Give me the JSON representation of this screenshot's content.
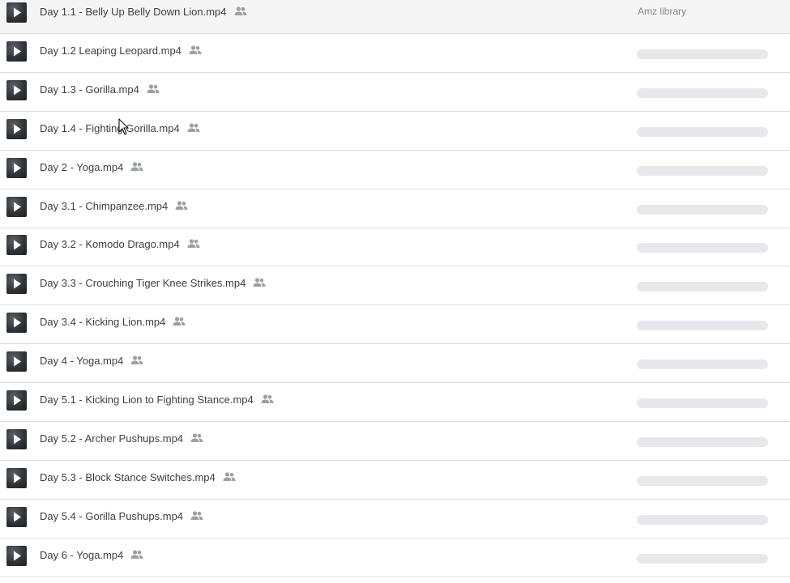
{
  "colors": {
    "text": "#3c4043",
    "muted": "#80868b",
    "divider": "#dadce0",
    "skeleton": "#e8e8ec",
    "shared_icon": "#9aa0a6"
  },
  "icons": {
    "thumbnail": "video-play-icon",
    "shared": "shared-people-icon",
    "cursor": "mouse-pointer-icon"
  },
  "files": [
    {
      "name": "Day 1.1 - Belly Up Belly Down Lion.mp4",
      "owner": "Amz library",
      "shared": true
    },
    {
      "name": "Day 1.2 Leaping Leopard.mp4",
      "owner": "",
      "shared": true
    },
    {
      "name": "Day 1.3 - Gorilla.mp4",
      "owner": "",
      "shared": true
    },
    {
      "name": "Day 1.4 - Fighting Gorilla.mp4",
      "owner": "",
      "shared": true
    },
    {
      "name": "Day 2 - Yoga.mp4",
      "owner": "",
      "shared": true
    },
    {
      "name": "Day 3.1 - Chimpanzee.mp4",
      "owner": "",
      "shared": true
    },
    {
      "name": "Day 3.2 - Komodo Drago.mp4",
      "owner": "",
      "shared": true
    },
    {
      "name": "Day 3.3 - Crouching Tiger Knee Strikes.mp4",
      "owner": "",
      "shared": true
    },
    {
      "name": "Day 3.4 - Kicking Lion.mp4",
      "owner": "",
      "shared": true
    },
    {
      "name": "Day 4 - Yoga.mp4",
      "owner": "",
      "shared": true
    },
    {
      "name": "Day 5.1 - Kicking Lion to Fighting Stance.mp4",
      "owner": "",
      "shared": true
    },
    {
      "name": "Day 5.2 - Archer Pushups.mp4",
      "owner": "",
      "shared": true
    },
    {
      "name": "Day 5.3 - Block Stance Switches.mp4",
      "owner": "",
      "shared": true
    },
    {
      "name": "Day 5.4 - Gorilla Pushups.mp4",
      "owner": "",
      "shared": true
    },
    {
      "name": "Day 6 - Yoga.mp4",
      "owner": "",
      "shared": true
    }
  ]
}
